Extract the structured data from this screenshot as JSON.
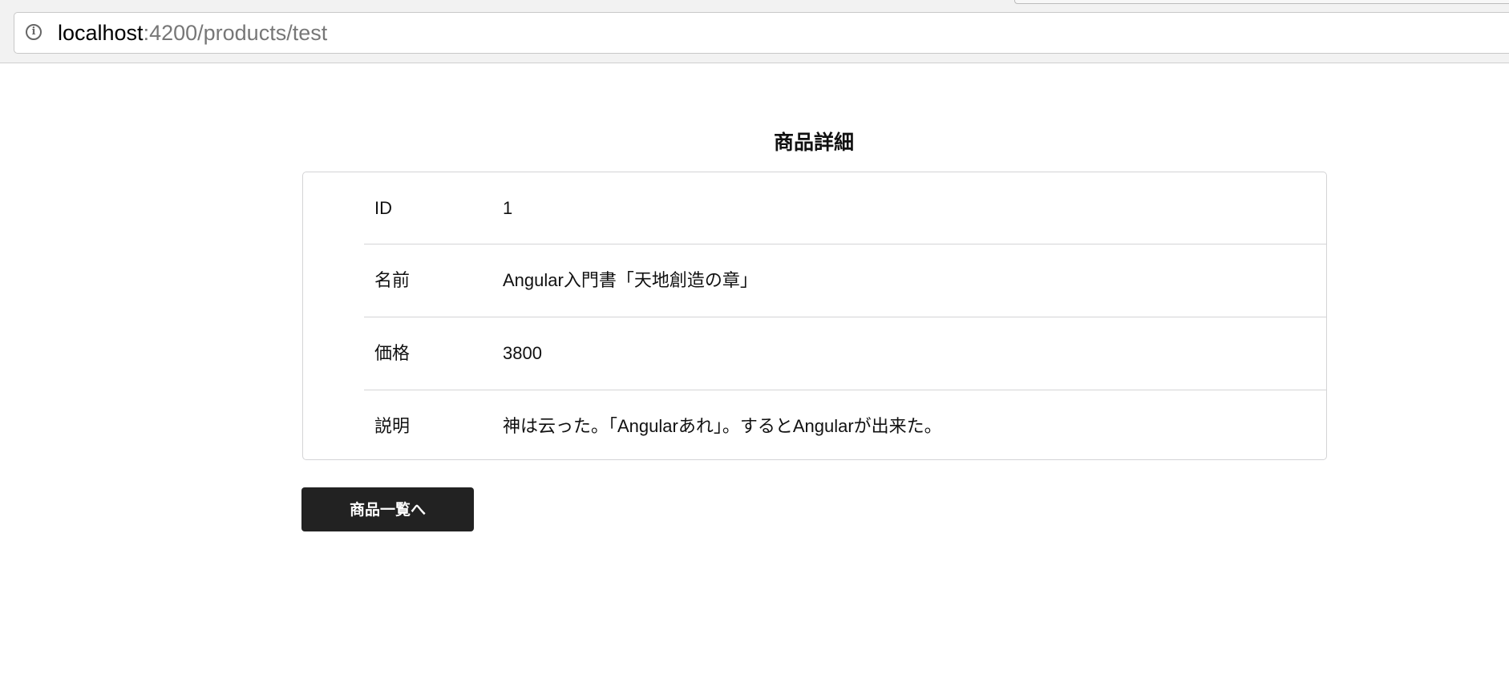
{
  "browser": {
    "url_host": "localhost",
    "url_path": ":4200/products/test",
    "info_icon": "info-icon"
  },
  "page": {
    "title": "商品詳細",
    "rows": [
      {
        "label": "ID",
        "value": "1"
      },
      {
        "label": "名前",
        "value": "Angular入門書「天地創造の章」"
      },
      {
        "label": "価格",
        "value": "3800"
      },
      {
        "label": "説明",
        "value": "神は云った。「Angularあれ」。するとAngularが出来た。"
      }
    ],
    "back_button": "商品一覧へ"
  }
}
